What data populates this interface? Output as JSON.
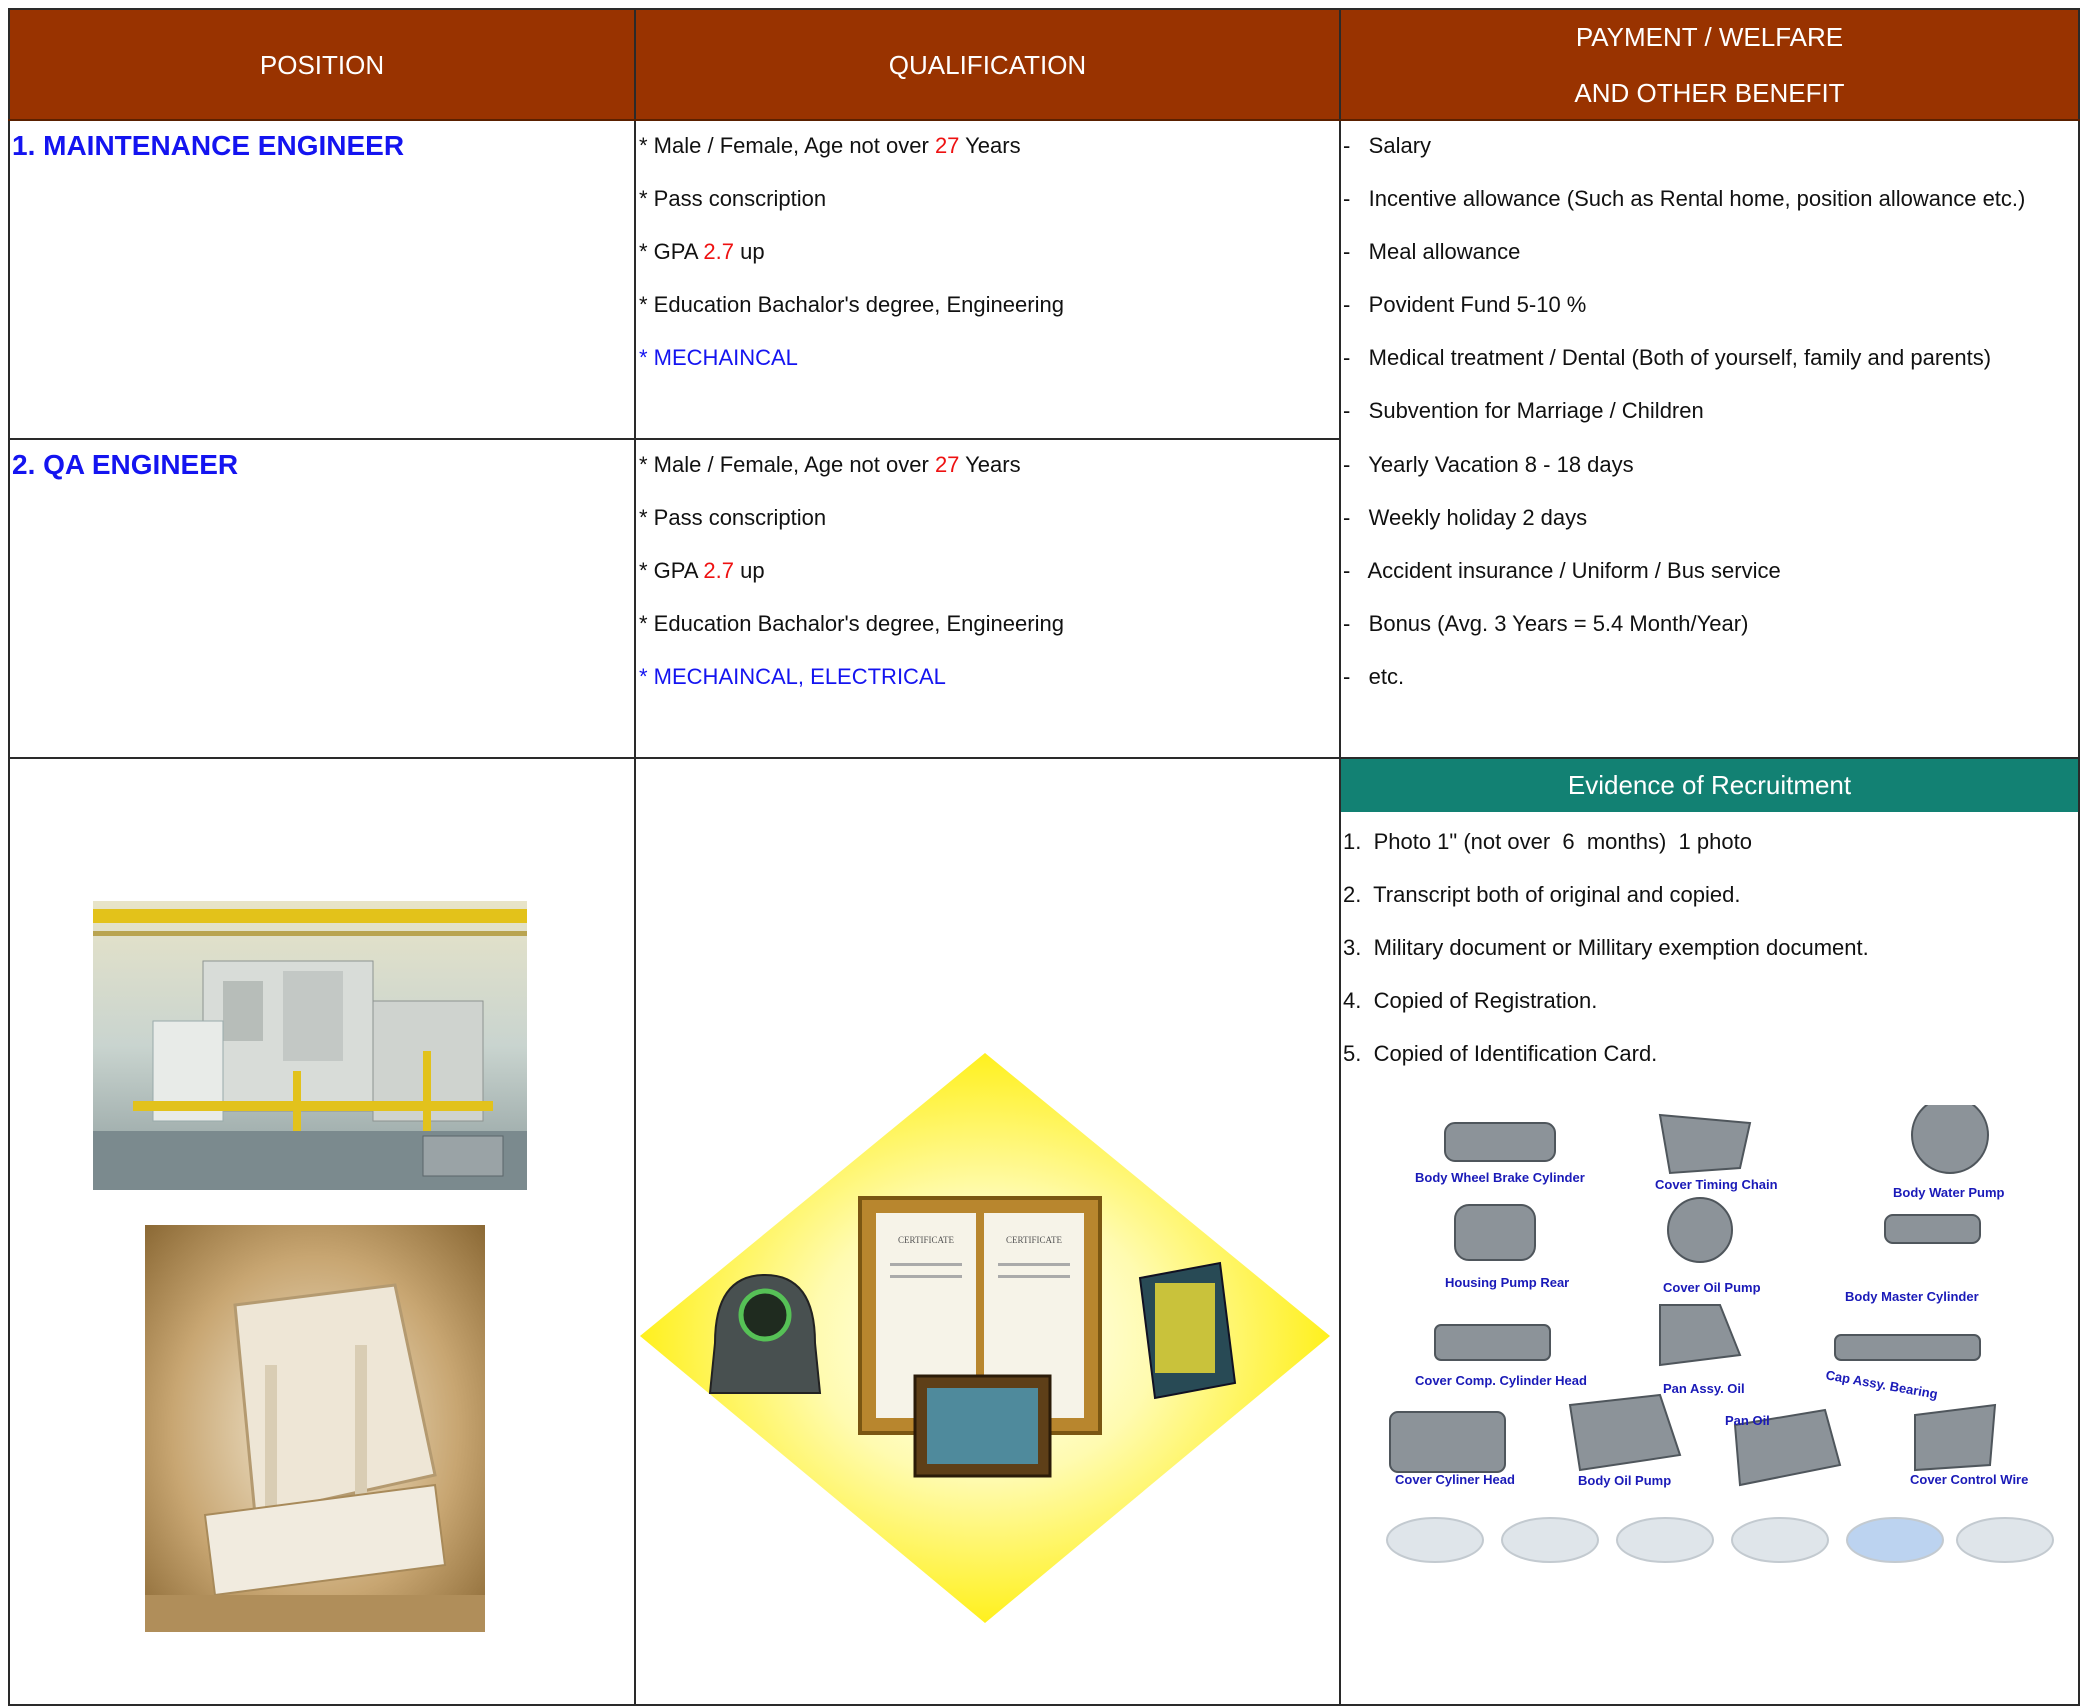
{
  "header": {
    "position": "POSITION",
    "qualification": "QUALIFICATION",
    "benefit_line1": "PAYMENT / WELFARE",
    "benefit_line2": "AND OTHER BENEFIT"
  },
  "positions": [
    {
      "title": "1. MAINTENANCE ENGINEER",
      "q1_prefix": "* Male / Female,  Age not over ",
      "q1_age": "27",
      "q1_suffix": " Years",
      "q2": "* Pass conscription",
      "q3_prefix": "* GPA ",
      "q3_gpa": "2.7",
      "q3_suffix": " up",
      "q4": "* Education Bachalor's degree, Engineering",
      "q5": "* MECHAINCAL"
    },
    {
      "title": "2. QA ENGINEER",
      "q1_prefix": "* Male / Female,  Age not over ",
      "q1_age": "27",
      "q1_suffix": " Years",
      "q2": "* Pass conscription",
      "q3_prefix": "* GPA ",
      "q3_gpa": "2.7",
      "q3_suffix": " up",
      "q4": "* Education Bachalor's degree, Engineering",
      "q5": "* MECHAINCAL, ELECTRICAL"
    }
  ],
  "benefits": [
    "-   Salary",
    "-   Incentive allowance (Such as Rental home, position allowance etc.)",
    "-   Meal allowance",
    "-   Povident Fund 5-10 %",
    "-   Medical treatment / Dental (Both of yourself, family and parents)",
    "-   Subvention for Marriage / Children",
    "-   Yearly Vacation 8 - 18 days",
    "-   Weekly holiday 2 days",
    "-   Accident insurance / Uniform / Bus service",
    "-   Bonus (Avg. 3 Years = 5.4 Month/Year)",
    "-   etc."
  ],
  "evidence": {
    "title": "Evidence of Recruitment",
    "items": [
      "1.  Photo 1\" (not over  6  months)  1 photo",
      "2.  Transcript both of original and copied.",
      "3.  Military document or Millitary exemption document.",
      "4.  Copied of Registration.",
      "5.  Copied of Identification Card."
    ]
  },
  "products": [
    "Body Wheel Brake Cylinder",
    "Cover Timing Chain",
    "Body Water Pump",
    "Housing Pump Rear",
    "Cover Oil Pump",
    "Body Master Cylinder",
    "Cover Comp. Cylinder Head",
    "Pan Assy. Oil",
    "Cap Assy. Bearing",
    "Pan Oil",
    "Cover Cyliner Head",
    "Body Oil Pump",
    "Cover Control Wire"
  ],
  "certificate_text": [
    "CERTIFICATE",
    "CERTIFICATE"
  ],
  "colors": {
    "header_bg": "#993300",
    "title_blue": "#1414f0",
    "highlight_red": "#ee1111",
    "evidence_bg": "#128173",
    "diamond": "#ffee00"
  }
}
